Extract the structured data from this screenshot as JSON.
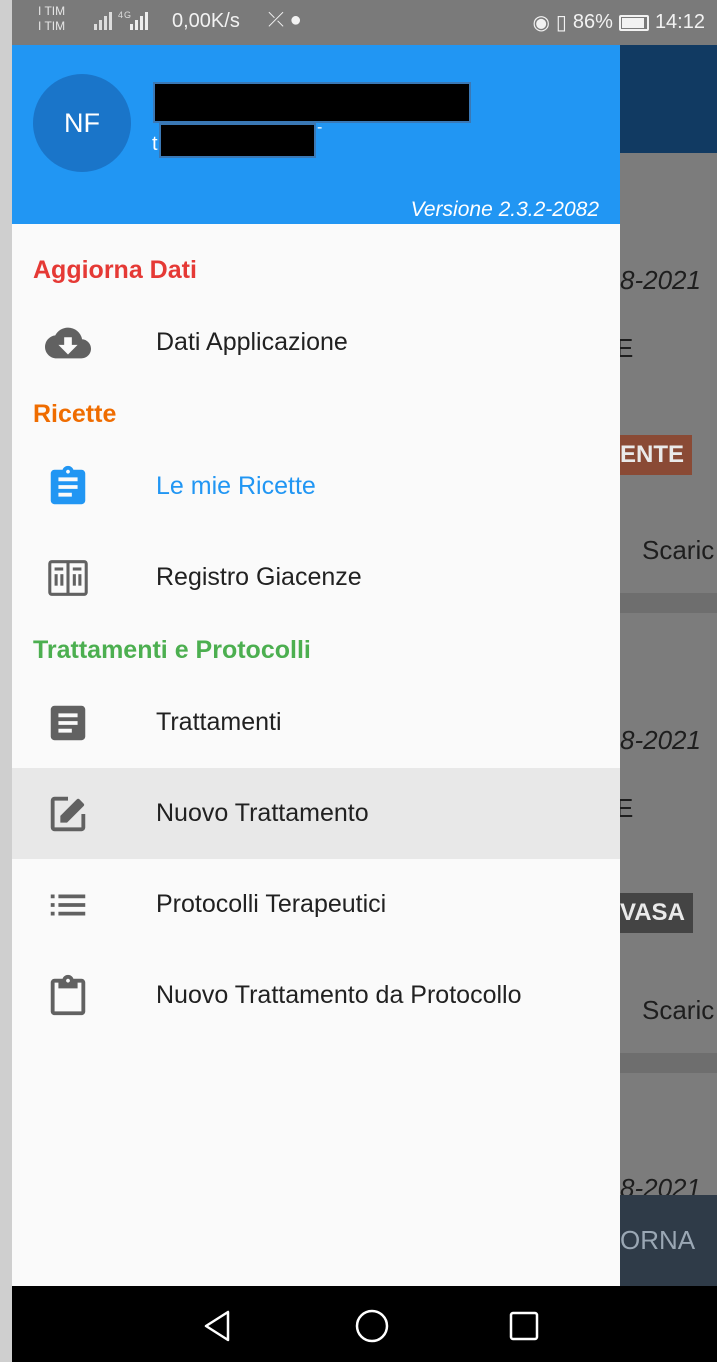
{
  "status_bar": {
    "carrier_1": "I TIM",
    "carrier_2": "I TIM",
    "network": "4G",
    "speed": "0,00K/s",
    "battery": "86%",
    "battery_level": 0.86,
    "time": "14:12"
  },
  "drawer": {
    "header": {
      "avatar_initials": "NF",
      "version": "Versione 2.3.2-2082",
      "background_color": "#2196f3"
    },
    "sections": [
      {
        "title": "Aggiorna Dati",
        "color": "#e53935",
        "items": [
          {
            "label": "Dati Applicazione",
            "icon": "cloud-download-icon",
            "active": false,
            "highlighted": false
          }
        ]
      },
      {
        "title": "Ricette",
        "color": "#ef6c00",
        "items": [
          {
            "label": "Le mie Ricette",
            "icon": "clipboard-text-icon",
            "active": false,
            "highlighted": true
          },
          {
            "label": "Registro Giacenze",
            "icon": "register-icon",
            "active": false,
            "highlighted": false
          }
        ]
      },
      {
        "title": "Trattamenti e Protocolli",
        "color": "#4caf50",
        "items": [
          {
            "label": "Trattamenti",
            "icon": "document-icon",
            "active": false,
            "highlighted": false
          },
          {
            "label": "Nuovo Trattamento",
            "icon": "edit-icon",
            "active": true,
            "highlighted": false
          },
          {
            "label": "Protocolli Terapeutici",
            "icon": "list-icon",
            "active": false,
            "highlighted": false
          },
          {
            "label": "Nuovo Trattamento da Protocollo",
            "icon": "clipboard-icon",
            "active": false,
            "highlighted": false
          }
        ]
      }
    ]
  },
  "background": {
    "date_1": "8-2021",
    "letter_1": "E",
    "badge_1": "ENTE",
    "action_1": "Scaric",
    "date_2": "8-2021",
    "letter_2": "E",
    "badge_2": "VASA",
    "action_2": "Scaric",
    "date_3": "8-2021",
    "bottom_button": "ORNA"
  },
  "navigation_bar": {
    "buttons": [
      "back",
      "home",
      "recents"
    ]
  }
}
